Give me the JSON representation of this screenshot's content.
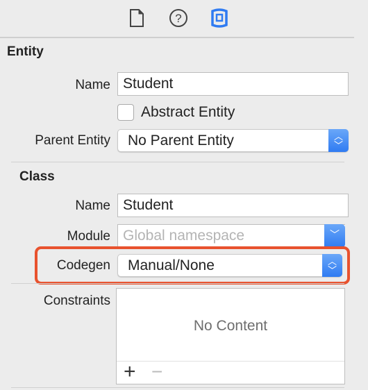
{
  "toolbar": {
    "icons": [
      "file-icon",
      "help-icon",
      "data-model-inspector-icon"
    ],
    "accent": "#2f7bf2"
  },
  "entity": {
    "heading": "Entity",
    "name_label": "Name",
    "name_value": "Student",
    "abstract_label": "Abstract Entity",
    "abstract_checked": false,
    "parent_label": "Parent Entity",
    "parent_value": "No Parent Entity"
  },
  "class": {
    "heading": "Class",
    "name_label": "Name",
    "name_value": "Student",
    "module_label": "Module",
    "module_placeholder": "Global namespace",
    "codegen_label": "Codegen",
    "codegen_value": "Manual/None",
    "highlight_color": "#e8522e"
  },
  "constraints": {
    "label": "Constraints",
    "empty_text": "No Content",
    "add": "+",
    "remove": "−"
  }
}
